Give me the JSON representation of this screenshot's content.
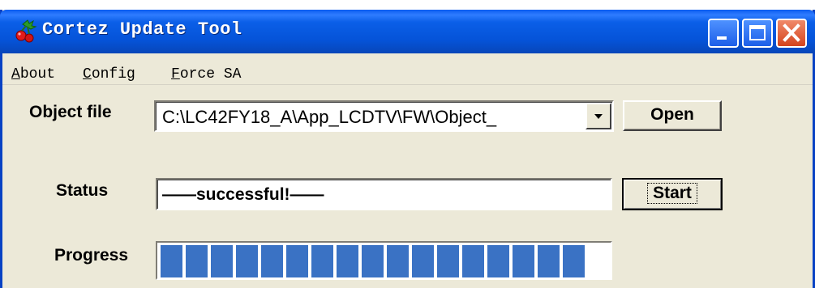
{
  "window": {
    "title": "Cortez Update Tool",
    "accent": "#0553d8",
    "icon": "app-berry-icon"
  },
  "caption_buttons": {
    "minimize_icon": "minimize-icon",
    "maximize_icon": "maximize-icon",
    "close_icon": "close-icon"
  },
  "menu": {
    "items": [
      {
        "hotkey": "A",
        "rest": "bout"
      },
      {
        "hotkey": "C",
        "rest": "onfig"
      },
      {
        "hotkey": "F",
        "rest": "orce SA"
      }
    ]
  },
  "object_file": {
    "label": "Object file",
    "value": "C:\\LC42FY18_A\\App_LCDTV\\FW\\Object_",
    "dropdown_icon": "chevron-down-icon",
    "open_label": "Open"
  },
  "status": {
    "label": "Status",
    "text": "——successful!——",
    "start_label": "Start"
  },
  "progress": {
    "label": "Progress",
    "percent": 100,
    "color": "#3a72c4"
  }
}
